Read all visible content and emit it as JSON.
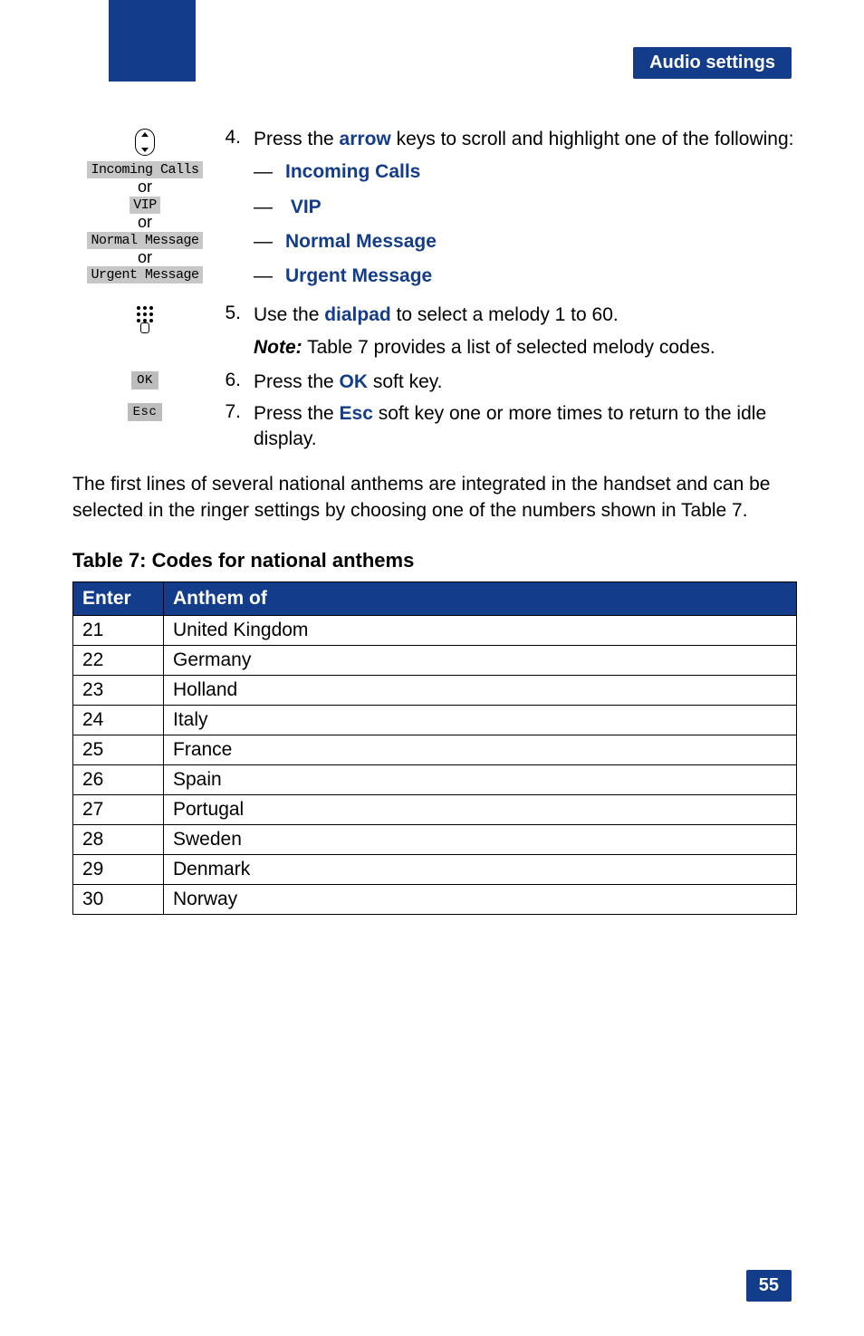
{
  "header": {
    "section_title": "Audio settings"
  },
  "steps": {
    "s4": {
      "num": "4.",
      "text_before": "Press the ",
      "arrow": "arrow",
      "text_after": " keys to scroll and highlight one of the following:",
      "options": [
        "Incoming Calls",
        "VIP",
        "Normal Message",
        "Urgent Message"
      ],
      "icon_labels": {
        "incoming": "Incoming Calls",
        "vip": "VIP",
        "normal": "Normal Message",
        "urgent": "Urgent Message",
        "or": "or"
      }
    },
    "s5": {
      "num": "5.",
      "text_before": "Use the ",
      "dialpad": "dialpad",
      "text_after": " to select a melody 1 to 60.",
      "note_label": "Note:",
      "note_text": " Table 7 provides a list of selected melody codes."
    },
    "s6": {
      "num": "6.",
      "text_before": "Press the ",
      "ok": "OK",
      "text_after": " soft key.",
      "softkey": "OK"
    },
    "s7": {
      "num": "7.",
      "text_before": "Press the ",
      "esc": "Esc",
      "text_after": " soft key one or more times to return to the idle display.",
      "softkey": "Esc"
    }
  },
  "paragraph": "The first lines of several national anthems are integrated in the handset and can be selected in the ringer settings by choosing one of the numbers shown in Table 7.",
  "table": {
    "caption": "Table 7: Codes for national anthems",
    "headers": [
      "Enter",
      "Anthem of"
    ],
    "rows": [
      [
        "21",
        "United Kingdom"
      ],
      [
        "22",
        "Germany"
      ],
      [
        "23",
        "Holland"
      ],
      [
        "24",
        "Italy"
      ],
      [
        "25",
        "France"
      ],
      [
        "26",
        "Spain"
      ],
      [
        "27",
        "Portugal"
      ],
      [
        "28",
        "Sweden"
      ],
      [
        "29",
        "Denmark"
      ],
      [
        "30",
        "Norway"
      ]
    ]
  },
  "page_number": "55"
}
